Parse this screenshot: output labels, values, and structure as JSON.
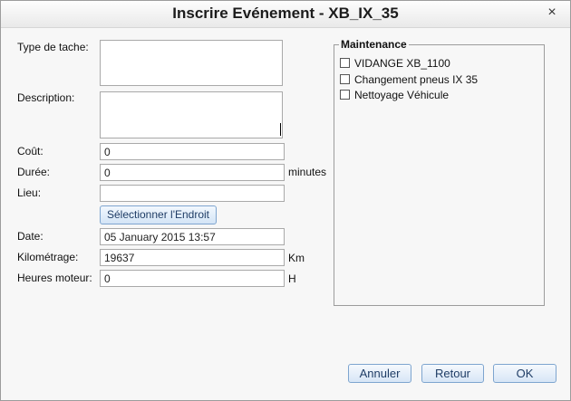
{
  "dialog": {
    "title": "Inscrire Evénement - XB_IX_35",
    "close_glyph": "×"
  },
  "form": {
    "task_type_label": "Type de tache:",
    "task_type_value": "",
    "description_label": "Description:",
    "description_value": "",
    "cost_label": "Coût:",
    "cost_value": "0",
    "duration_label": "Durée:",
    "duration_value": "0",
    "duration_unit": "minutes",
    "place_label": "Lieu:",
    "place_value": "",
    "select_place_button": "Sélectionner l'Endroit",
    "date_label": "Date:",
    "date_value": "05 January 2015 13:57",
    "mileage_label": "Kilométrage:",
    "mileage_value": "19637",
    "mileage_unit": "Km",
    "engine_hours_label": "Heures moteur:",
    "engine_hours_value": "0",
    "engine_hours_unit": "H"
  },
  "maintenance": {
    "legend": "Maintenance",
    "items": [
      {
        "label": "VIDANGE XB_1100",
        "checked": false
      },
      {
        "label": "Changement pneus IX 35",
        "checked": false
      },
      {
        "label": "Nettoyage Véhicule",
        "checked": false
      }
    ]
  },
  "buttons": {
    "cancel": "Annuler",
    "back": "Retour",
    "ok": "OK"
  },
  "icons": {
    "close": "close-icon"
  }
}
